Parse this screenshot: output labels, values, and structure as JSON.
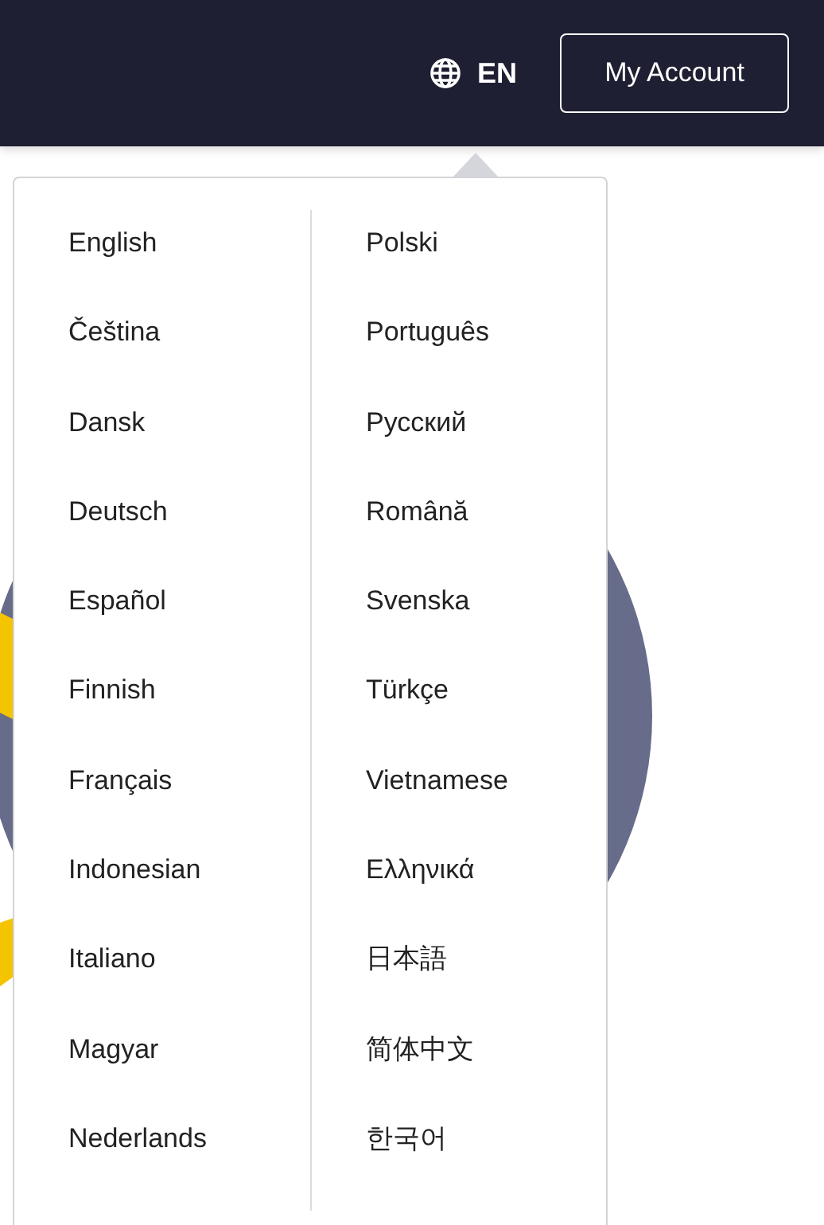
{
  "header": {
    "language_code": "EN",
    "account_button": "My Account"
  },
  "language_menu": {
    "columns": [
      [
        "English",
        "Čeština",
        "Dansk",
        "Deutsch",
        "Español",
        "Finnish",
        "Français",
        "Indonesian",
        "Italiano",
        "Magyar",
        "Nederlands"
      ],
      [
        "Polski",
        "Português",
        "Русский",
        "Română",
        "Svenska",
        "Türkçe",
        "Vietnamese",
        "Ελληνικά",
        "日本語",
        "简体中文",
        "한국어"
      ]
    ]
  }
}
